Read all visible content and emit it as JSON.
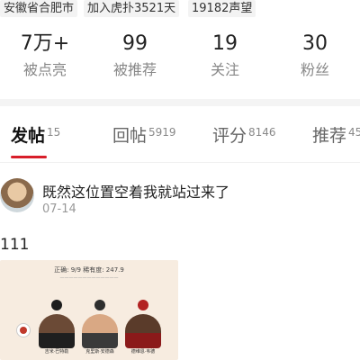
{
  "profile": {
    "tags": [
      "安徽省合肥市",
      "加入虎扑3521天",
      "19182声望"
    ],
    "stats": [
      {
        "value": "7万+",
        "label": "被点亮"
      },
      {
        "value": "99",
        "label": "被推荐"
      },
      {
        "value": "19",
        "label": "关注"
      },
      {
        "value": "30",
        "label": "粉丝"
      }
    ]
  },
  "tabs": [
    {
      "label": "发帖",
      "count": "15",
      "active": true
    },
    {
      "label": "回帖",
      "count": "5919",
      "active": false
    },
    {
      "label": "评分",
      "count": "8146",
      "active": false
    },
    {
      "label": "推荐",
      "count": "45",
      "active": false
    }
  ],
  "post": {
    "title": "既然这位置空着我就站过来了",
    "date": "07-14",
    "body": "111",
    "image": {
      "header": "正确: 9/9    稀有度: 247.9",
      "players": [
        "吉米·巴特勒",
        "克里斯·安德森",
        "德维恩·韦德"
      ]
    }
  },
  "colors": {
    "accent": "#d81e2a",
    "tag_bg": "#f3f3f3",
    "muted": "#888888"
  }
}
